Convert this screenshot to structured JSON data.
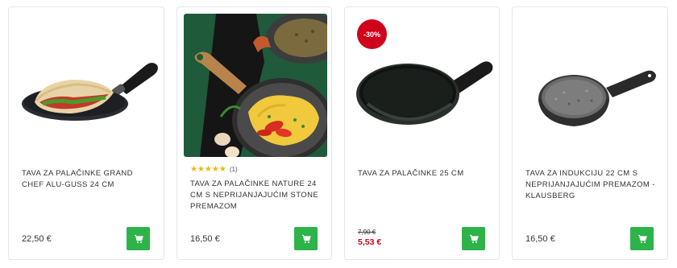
{
  "colors": {
    "cart_button": "#2db34a",
    "sale_red": "#d0021b",
    "star_yellow": "#f5b301",
    "card_border": "#e6e6e6"
  },
  "products": [
    {
      "title": "TAVA ZA PALAČINKE GRAND CHEF ALU-GUSS 24 CM",
      "price": "22,50 €",
      "image_icon": "crepe-pan-with-wrap-image",
      "cart_icon": "shopping-cart-icon"
    },
    {
      "title": "TAVA ZA PALAČINKE NATURE 24 CM S NEPRIJANJAJUĆIM STONE PREMAZOM",
      "price": "16,50 €",
      "rating": {
        "stars": "★★★★★",
        "count": "(1)",
        "value": 5,
        "max": 5
      },
      "image_icon": "stone-pan-omelette-image",
      "cart_icon": "shopping-cart-icon"
    },
    {
      "title": "TAVA ZA PALAČINKE 25 CM",
      "old_price": "7,90 €",
      "sale_price": "5,53 €",
      "badge": "-30%",
      "image_icon": "black-crepe-pan-image",
      "cart_icon": "shopping-cart-icon"
    },
    {
      "title": "TAVA ZA INDUKCIJU 22 CM S NEPRIJANJAJUĆIM PREMAZOM - KLAUSBERG",
      "price": "16,50 €",
      "image_icon": "granite-frying-pan-image",
      "cart_icon": "shopping-cart-icon"
    }
  ]
}
